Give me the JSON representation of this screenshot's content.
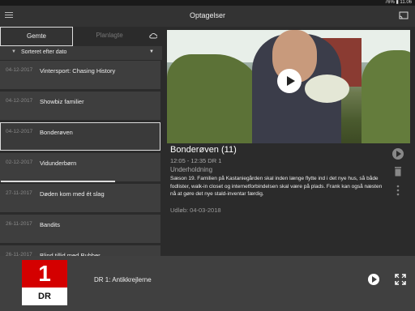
{
  "status_bar": {
    "right_text": "76% ▮ 11.06"
  },
  "header": {
    "title": "Optagelser"
  },
  "tabs": {
    "saved": "Gemte",
    "planned": "Planlagte"
  },
  "sort": {
    "label": "Sorteret efter dato"
  },
  "recordings": [
    {
      "date": "04-12-2017",
      "title": "Vintersport: Chasing History"
    },
    {
      "date": "04-12-2017",
      "title": "Showbiz familier"
    },
    {
      "date": "04-12-2017",
      "title": "Bonderøven",
      "selected": true
    },
    {
      "date": "02-12-2017",
      "title": "Vidunderbørn",
      "progress": 0.72
    },
    {
      "date": "27-11-2017",
      "title": "Døden kom med ét slag"
    },
    {
      "date": "26-11-2017",
      "title": "Bandits"
    },
    {
      "date": "26-11-2017",
      "title": "Blind tillid med Bubber"
    }
  ],
  "detail": {
    "title": "Bonderøven (11)",
    "time_channel": "12:05 - 12:35  DR 1",
    "genre": "Underholdning",
    "description": "Sæson 19. Familien på Kastaniegården skal inden længe flytte ind i det nye hus, så både fodlister, walk-in closet og internetforbindelsen skal være på plads. Frank kan også næsten nå at gøre det nye stald-inventar færdig.",
    "expiry": "Udløb: 04-03-2018"
  },
  "player": {
    "logo_number": "1",
    "logo_text": "DR",
    "now_playing": "DR 1: Antikkrejlerne"
  }
}
